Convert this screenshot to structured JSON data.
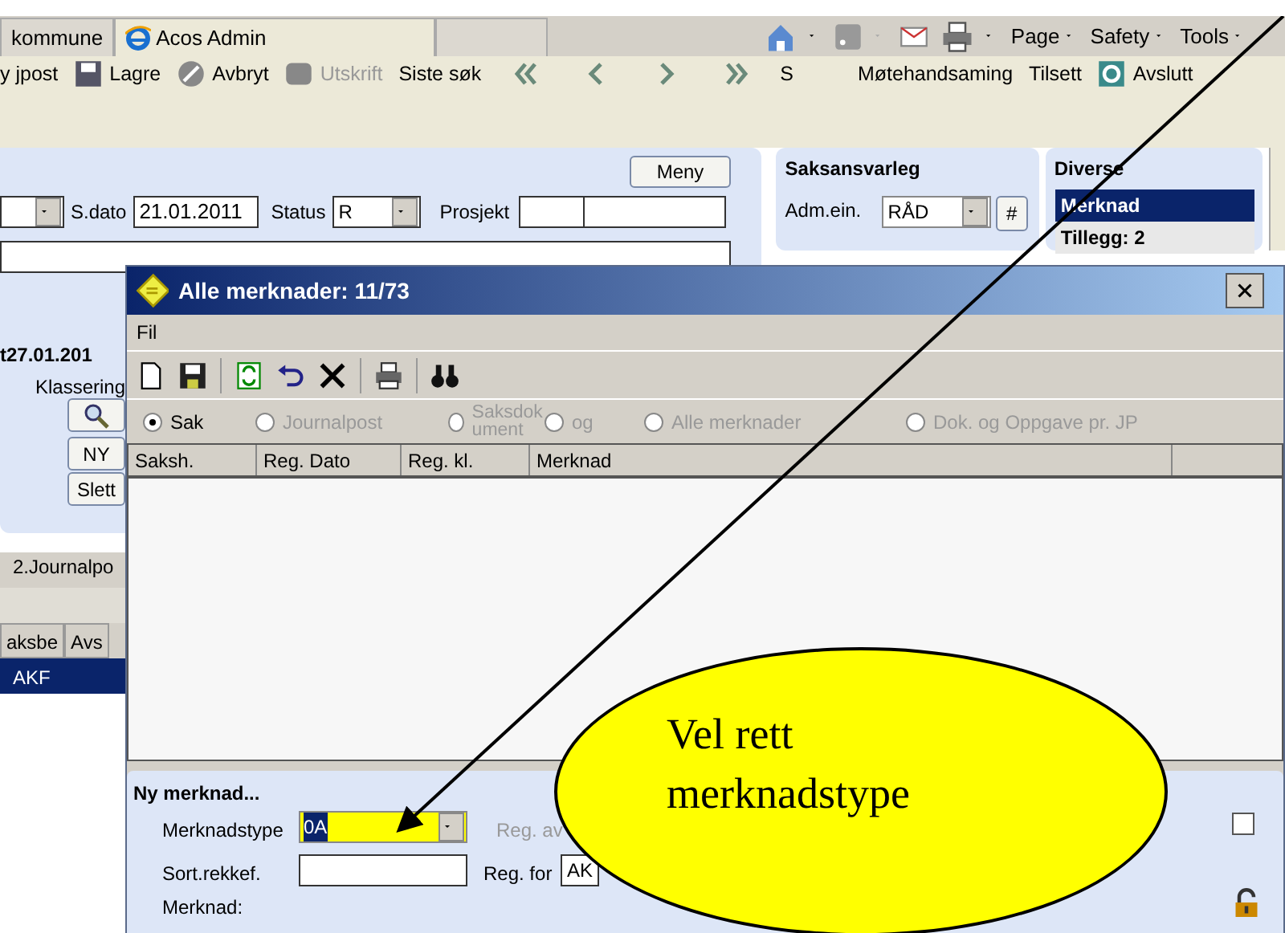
{
  "browser": {
    "tabs": [
      {
        "label": "kommune",
        "selected": false
      },
      {
        "label": "Acos Admin",
        "selected": true
      }
    ],
    "menus": [
      "Page",
      "Safety",
      "Tools"
    ]
  },
  "toolbar": [
    {
      "label": "y jpost",
      "disabled": false
    },
    {
      "label": "Lagre",
      "disabled": false
    },
    {
      "label": "Avbryt",
      "disabled": false
    },
    {
      "label": "Utskrift",
      "disabled": true
    },
    {
      "label": "Siste søk",
      "disabled": false
    },
    {
      "label": "S",
      "disabled": false
    },
    {
      "label": "Møtehandsaming",
      "disabled": false
    },
    {
      "label": "Tilsett",
      "disabled": false
    },
    {
      "label": "Avslutt",
      "disabled": false
    }
  ],
  "case": {
    "menu_button": "Meny",
    "sdato_label": "S.dato",
    "sdato": "21.01.2011",
    "status_label": "Status",
    "status": "R",
    "project_label": "Prosjekt",
    "date_text": "t27.01.201",
    "klassering": "Klassering",
    "buttons": [
      "NY",
      "Slett"
    ],
    "tab": "2.Journalpo",
    "columns": [
      "aksbe",
      "Avs"
    ],
    "rows": [
      {
        "text": "AKF",
        "selected": true
      }
    ]
  },
  "saksansvarleg": {
    "title": "Saksansvarleg",
    "label": "Adm.ein.",
    "value": "RÅD",
    "hash_button": "#"
  },
  "diverse": {
    "title": "Diverse",
    "items": [
      {
        "label": "Merknad",
        "selected": true
      },
      {
        "label": "Tillegg: 2",
        "selected": false
      }
    ]
  },
  "dialog": {
    "title": "Alle merknader: 11/73",
    "menu": [
      "Fil"
    ],
    "radios": [
      {
        "label": "Sak",
        "selected": true,
        "disabled": false
      },
      {
        "label": "Journalpost",
        "selected": false,
        "disabled": true
      },
      {
        "label": "Saksdokument",
        "selected": false,
        "disabled": true
      },
      {
        "label": "og",
        "selected": false,
        "disabled": true
      },
      {
        "label": "Alle merknader",
        "selected": false,
        "disabled": true
      },
      {
        "label": "Dok. og Oppgave pr. JP",
        "selected": false,
        "disabled": true
      }
    ],
    "columns": [
      "Saksh.",
      "Reg. Dato",
      "Reg. kl.",
      "Merknad"
    ],
    "form": {
      "title": "Ny merknad...",
      "type_label": "Merknadstype",
      "type_value": "0A",
      "sort_label": "Sort.rekkef.",
      "note_label": "Merknad:",
      "reg_av_label": "Reg. av",
      "reg_for_label": "Reg. for",
      "reg_for_value": "AK",
      "checked": false
    }
  },
  "callout": {
    "text": "Vel rett merknadstype"
  }
}
